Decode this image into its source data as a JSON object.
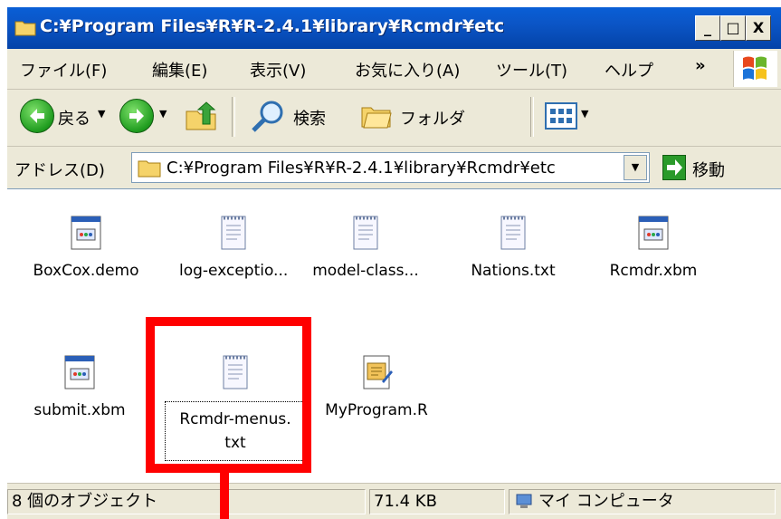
{
  "window": {
    "title": "C:¥Program Files¥R¥R-2.4.1¥library¥Rcmdr¥etc",
    "buttons": {
      "minimize": "_",
      "maximize": "□",
      "close": "X"
    }
  },
  "menu": {
    "items": [
      "ファイル(F)",
      "編集(E)",
      "表示(V)",
      "お気に入り(A)",
      "ツール(T)",
      "ヘルプ"
    ],
    "overflow": "»"
  },
  "toolbar": {
    "back_label": "戻る",
    "search_label": "検索",
    "folders_label": "フォルダ"
  },
  "address": {
    "label": "アドレス(D)",
    "value": "C:¥Program Files¥R¥R-2.4.1¥library¥Rcmdr¥etc",
    "go_label": "移動"
  },
  "files": [
    {
      "name": "BoxCox.demo",
      "icon": "xbm-window-icon"
    },
    {
      "name": "log-exceptio...",
      "icon": "text-file-icon"
    },
    {
      "name": "model-class...",
      "icon": "text-file-icon"
    },
    {
      "name": "Nations.txt",
      "icon": "text-file-icon"
    },
    {
      "name": "Rcmdr.xbm",
      "icon": "xbm-window-icon"
    },
    {
      "name": "submit.xbm",
      "icon": "xbm-window-icon"
    },
    {
      "name": "Rcmdr-menus.txt",
      "icon": "text-file-icon",
      "selected": true
    },
    {
      "name": "MyProgram.R",
      "icon": "r-script-icon"
    }
  ],
  "selected_file": {
    "line1": "Rcmdr-menus.",
    "line2": "txt"
  },
  "status": {
    "objects": "8 個のオブジェクト",
    "size": "71.4 KB",
    "location": "マイ コンピュータ"
  },
  "colors": {
    "highlight": "#ff0000",
    "titlebar": "#0b55c6"
  }
}
